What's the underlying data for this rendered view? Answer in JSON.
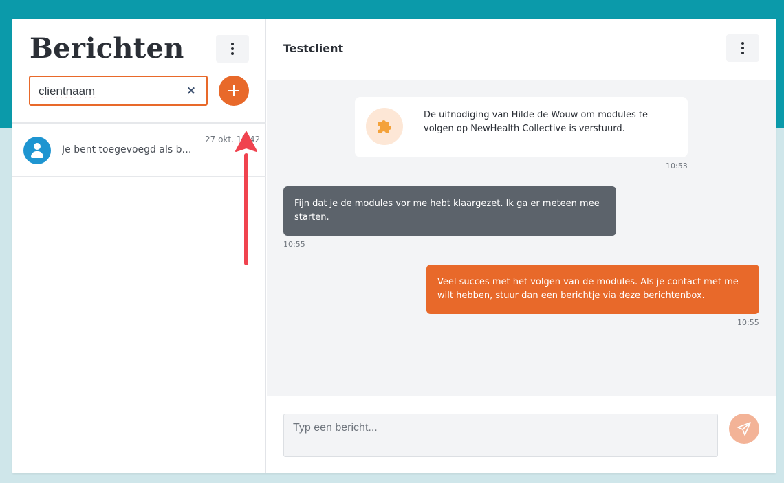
{
  "sidebar": {
    "title": "Berichten",
    "search": {
      "value": "clientnaam",
      "clear_glyph": "×"
    },
    "conversations": [
      {
        "preview": "Je bent toegevoegd als beg...",
        "timestamp": "27 okt. 12:42"
      }
    ]
  },
  "chat": {
    "title": "Testclient",
    "messages": [
      {
        "type": "system",
        "icon": "puzzle-icon",
        "text": "De uitnodiging van Hilde de Wouw om modules te volgen op NewHealth Collective is verstuurd.",
        "time": "10:53"
      },
      {
        "type": "incoming",
        "text": "Fijn dat je de modules vor me hebt klaargezet. Ik ga er meteen mee starten.",
        "time": "10:55"
      },
      {
        "type": "outgoing",
        "text": "Veel succes met het volgen van de modules. Als je contact met me wilt hebben, stuur dan een berichtje via deze berichtenbox.",
        "time": "10:55"
      }
    ],
    "composer": {
      "placeholder": "Typ een bericht..."
    }
  },
  "colors": {
    "teal_band": "#0b9aaa",
    "accent_orange": "#e8692a",
    "incoming_bubble": "#5c636b",
    "send_button_disabled": "#f3b397",
    "annotation_arrow": "#f0434f"
  }
}
